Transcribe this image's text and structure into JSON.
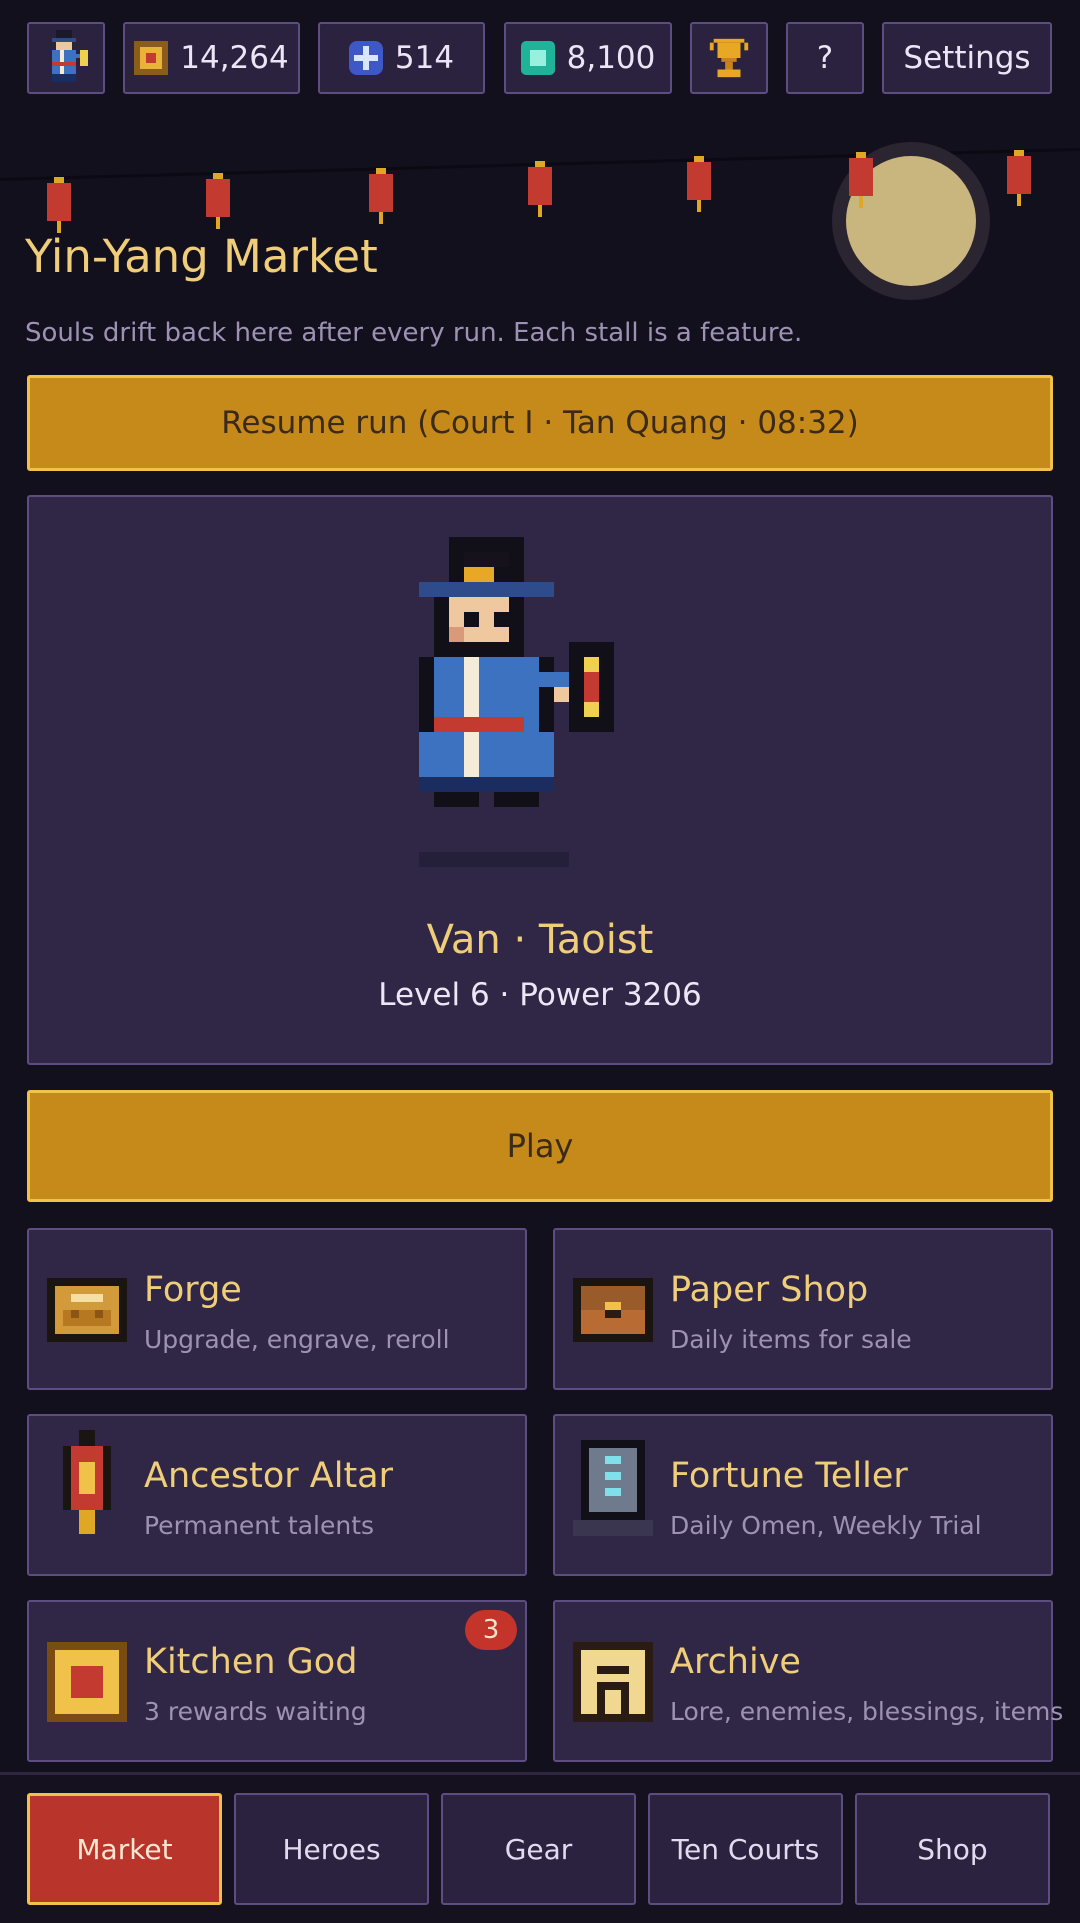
{
  "topbar": {
    "avatar_icon": "hero-portrait-icon",
    "coins": "14,264",
    "gems": "514",
    "jade": "8,100",
    "trophy_icon": "trophy-icon",
    "help_label": "?",
    "settings_label": "Settings"
  },
  "header": {
    "title": "Yin-Yang Market",
    "subtitle": "Souls drift back here after every run. Each stall is a feature."
  },
  "resume_button": "Resume run (Court I · Tan Quang · 08:32)",
  "hero": {
    "name": "Van · Taoist",
    "stats": "Level 6 · Power 3206"
  },
  "play_button": "Play",
  "tiles": [
    {
      "label": "Forge",
      "desc": "Upgrade, engrave, reroll",
      "icon": "anvil-icon"
    },
    {
      "label": "Paper Shop",
      "desc": "Daily items for sale",
      "icon": "chest-icon"
    },
    {
      "label": "Ancestor Altar",
      "desc": "Permanent talents",
      "icon": "lantern-icon"
    },
    {
      "label": "Fortune Teller",
      "desc": "Daily Omen, Weekly Trial",
      "icon": "tablet-icon"
    },
    {
      "label": "Kitchen God",
      "desc": "3 rewards waiting",
      "icon": "shrine-icon",
      "badge": "3"
    },
    {
      "label": "Archive",
      "desc": "Lore, enemies, blessings, items",
      "icon": "archive-icon"
    }
  ],
  "nav": {
    "items": [
      "Market",
      "Heroes",
      "Gear",
      "Ten Courts",
      "Shop"
    ],
    "active": "Market"
  },
  "colors": {
    "background": "#13101d",
    "panel": "#302746",
    "accent_gold": "#c68a1b",
    "active_red": "#b9352c",
    "title_gold": "#efcd79"
  }
}
